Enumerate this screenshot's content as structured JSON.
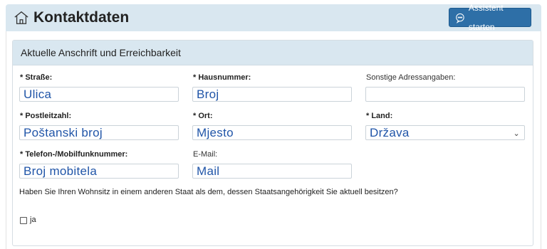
{
  "header": {
    "title": "Kontaktdaten",
    "assistant_button": "Assistent starten"
  },
  "card": {
    "title": "Aktuelle Anschrift und Erreichbarkeit"
  },
  "fields": {
    "strasse": {
      "label": "* Straße:",
      "value": "Ulica"
    },
    "hausnummer": {
      "label": "* Hausnummer:",
      "value": "Broj"
    },
    "sonstige": {
      "label": "Sonstige Adressangaben:",
      "value": ""
    },
    "plz": {
      "label": "* Postleitzahl:",
      "value": "Poštanski broj"
    },
    "ort": {
      "label": "* Ort:",
      "value": "Mjesto"
    },
    "land": {
      "label": "* Land:",
      "value": "Država"
    },
    "telefon": {
      "label": "* Telefon-/Mobilfunknummer:",
      "value": "Broj mobitela"
    },
    "email": {
      "label": "E-Mail:",
      "value": "Mail"
    }
  },
  "question": "Haben Sie Ihren Wohnsitz in einem anderen Staat als dem, dessen Staatsangehörigkeit Sie aktuell besitzen?",
  "checkbox": {
    "label": "ja",
    "checked": false
  },
  "colors": {
    "header_bg": "#d9e7f0",
    "button_bg": "#2e6fa7",
    "value_text": "#2055a8"
  },
  "icons": {
    "header": "house-icon",
    "button": "chat-bubble-icon",
    "select": "chevron-down-icon"
  }
}
